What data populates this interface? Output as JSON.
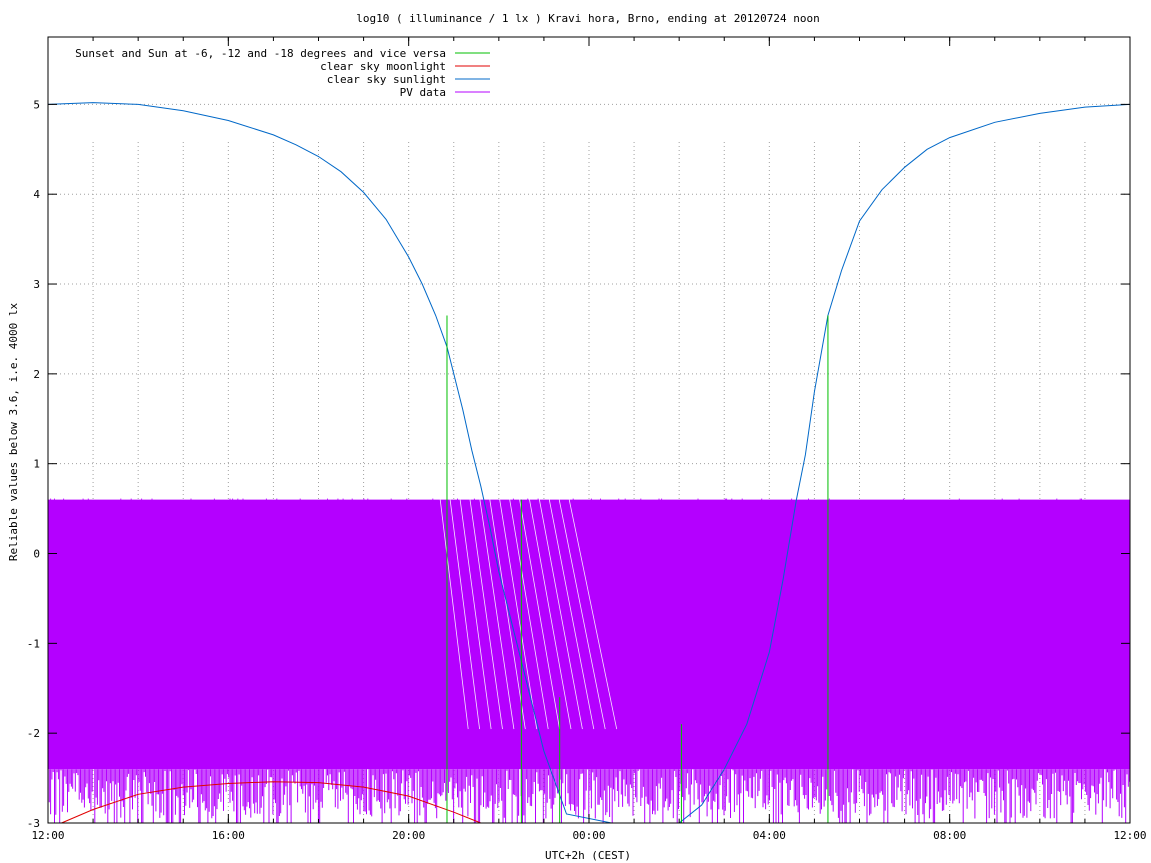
{
  "chart_data": {
    "type": "line",
    "title": "log10 ( illuminance / 1 lx ) Kravi hora, Brno, ending at 20120724 noon",
    "xlabel": "UTC+2h (CEST)",
    "ylabel": "Reliable values below 3.6, i.e. 4000 lx",
    "xlim": [
      0,
      24
    ],
    "ylim": [
      -3,
      5.75
    ],
    "x_ticks": [
      {
        "value": 0,
        "label": "12:00"
      },
      {
        "value": 4,
        "label": "16:00"
      },
      {
        "value": 8,
        "label": "20:00"
      },
      {
        "value": 12,
        "label": "00:00"
      },
      {
        "value": 16,
        "label": "04:00"
      },
      {
        "value": 20,
        "label": "08:00"
      },
      {
        "value": 24,
        "label": "12:00"
      }
    ],
    "y_ticks": [
      -3,
      -2,
      -1,
      0,
      1,
      2,
      3,
      4,
      5
    ],
    "grid": true,
    "legend_position": "top-left",
    "series": [
      {
        "name": "Sunset and Sun at -6, -12 and -18 degrees and vice versa",
        "color": "#00bf00",
        "kind": "vertical-markers",
        "points": [
          {
            "x": 8.85,
            "y_top": 2.65
          },
          {
            "x": 10.5,
            "y_top": 0.6
          },
          {
            "x": 11.35,
            "y_top": -1.6
          },
          {
            "x": 14.05,
            "y_top": -1.9
          },
          {
            "x": 17.3,
            "y_top": 2.65
          }
        ]
      },
      {
        "name": "clear sky moonlight",
        "color": "#e00000",
        "x": [
          0.3,
          1,
          2,
          3,
          4,
          5,
          6,
          7,
          8,
          9,
          9.6
        ],
        "y": [
          -3.0,
          -2.85,
          -2.68,
          -2.6,
          -2.56,
          -2.54,
          -2.55,
          -2.6,
          -2.7,
          -2.88,
          -3.0
        ]
      },
      {
        "name": "clear sky sunlight",
        "color": "#0068c8",
        "x": [
          0,
          1,
          2,
          3,
          4,
          5,
          5.5,
          6,
          6.5,
          7,
          7.5,
          8,
          8.3,
          8.6,
          8.85,
          9,
          9.2,
          9.4,
          9.6,
          9.8,
          10,
          10.2,
          10.5,
          11,
          11.5,
          12.5,
          14,
          14.5,
          15,
          15.5,
          16,
          16.3,
          16.6,
          16.8,
          17,
          17.3,
          17.6,
          18,
          18.5,
          19,
          19.5,
          20,
          21,
          22,
          23,
          24
        ],
        "y": [
          5.0,
          5.02,
          5.0,
          4.93,
          4.82,
          4.66,
          4.55,
          4.42,
          4.25,
          4.02,
          3.72,
          3.3,
          3.0,
          2.65,
          2.3,
          2.0,
          1.6,
          1.15,
          0.75,
          0.3,
          -0.2,
          -0.6,
          -1.2,
          -2.2,
          -2.9,
          -3.0,
          -3.0,
          -2.8,
          -2.4,
          -1.9,
          -1.1,
          -0.3,
          0.6,
          1.1,
          1.8,
          2.65,
          3.15,
          3.7,
          4.05,
          4.3,
          4.5,
          4.63,
          4.8,
          4.9,
          4.97,
          5.0
        ]
      },
      {
        "name": "PV data",
        "color": "#b400ff",
        "kind": "dense-spikes",
        "upper_level": 0.6,
        "floor_level": -2.4,
        "x_start": 0,
        "x_end": 24
      }
    ]
  }
}
